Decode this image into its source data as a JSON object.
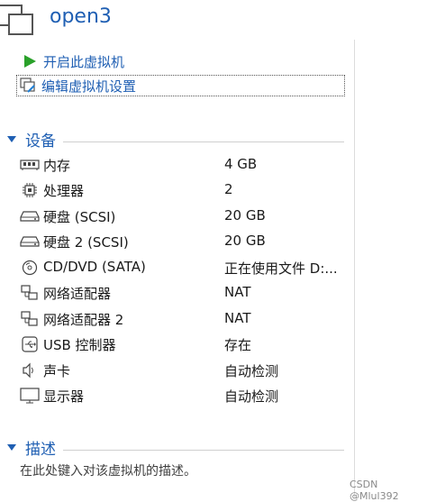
{
  "vm": {
    "title": "open3"
  },
  "actions": {
    "power_on": "开启此虚拟机",
    "edit_settings": "编辑虚拟机设置"
  },
  "sections": {
    "devices": "设备",
    "description": "描述"
  },
  "devices": [
    {
      "icon": "memory-icon",
      "name": "内存",
      "value": "4 GB"
    },
    {
      "icon": "processor-icon",
      "name": "处理器",
      "value": "2"
    },
    {
      "icon": "hard-disk-icon",
      "name": "硬盘 (SCSI)",
      "value": "20 GB"
    },
    {
      "icon": "hard-disk-icon",
      "name": "硬盘 2 (SCSI)",
      "value": "20 GB"
    },
    {
      "icon": "cd-dvd-icon",
      "name": "CD/DVD (SATA)",
      "value": "正在使用文件 D:..."
    },
    {
      "icon": "network-adapter-icon",
      "name": "网络适配器",
      "value": "NAT"
    },
    {
      "icon": "network-adapter-icon",
      "name": "网络适配器 2",
      "value": "NAT"
    },
    {
      "icon": "usb-icon",
      "name": "USB 控制器",
      "value": "存在"
    },
    {
      "icon": "speaker-icon",
      "name": "声卡",
      "value": "自动检测"
    },
    {
      "icon": "monitor-icon",
      "name": "显示器",
      "value": "自动检测"
    }
  ],
  "description": {
    "placeholder": "在此处键入对该虚拟机的描述。"
  },
  "watermark": "CSDN @Mlul392",
  "colors": {
    "accent": "#1f5fb3",
    "play": "#2aa12a"
  }
}
